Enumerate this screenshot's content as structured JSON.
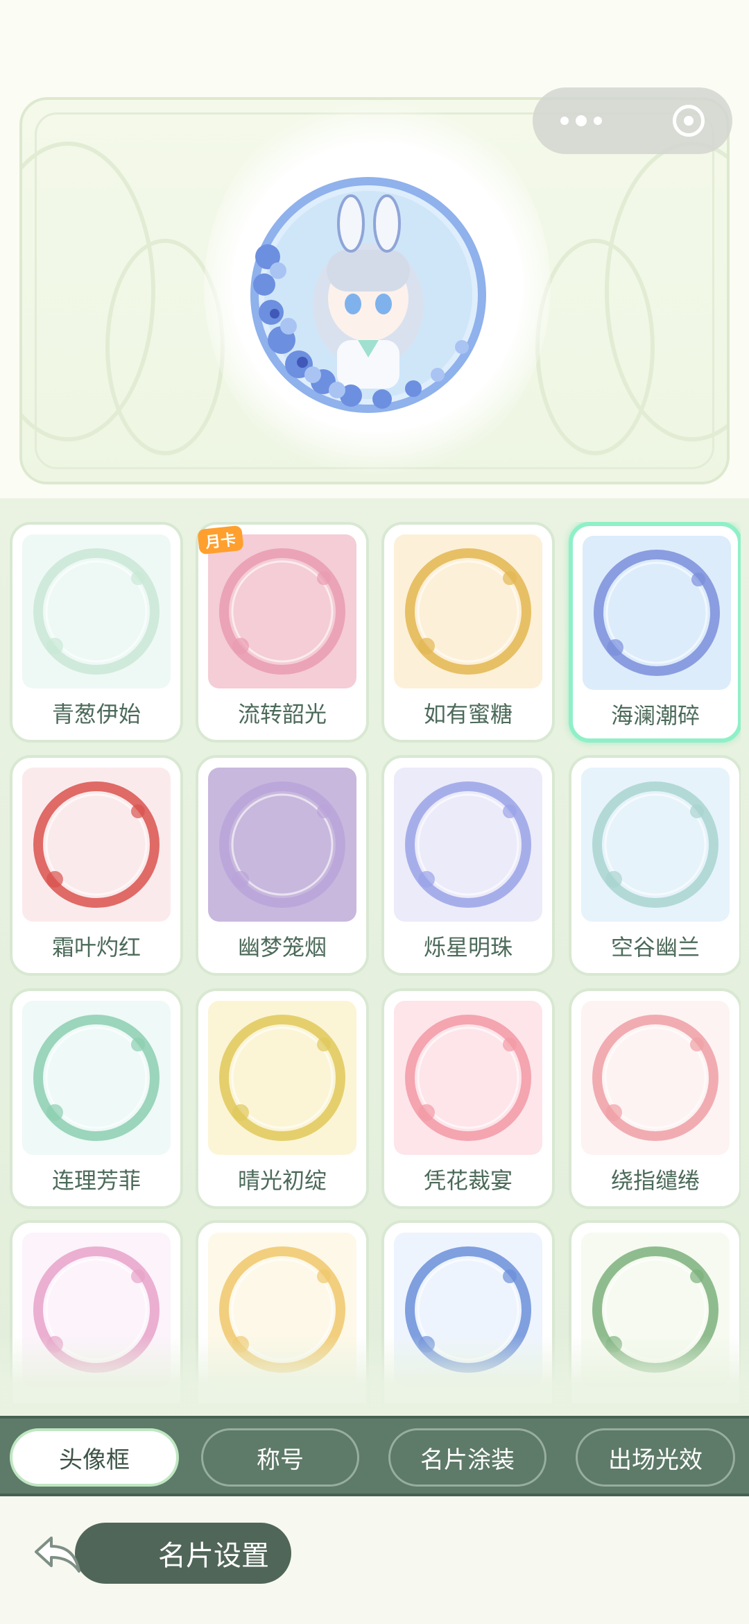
{
  "colors": {
    "accent": "#8ff0c7",
    "tab_bar": "#5e7a68",
    "label": "#4c6a5a"
  },
  "frames": [
    {
      "label": "青葱伊始",
      "bg": "#eef9f6"
    },
    {
      "label": "流转韶光",
      "bg": "#f4cdd6",
      "badge": "月卡"
    },
    {
      "label": "如有蜜糖",
      "bg": "#fdf0d8"
    },
    {
      "label": "海澜潮碎",
      "bg": "#dcecfb"
    },
    {
      "label": "霜叶灼红",
      "bg": "#fbeaec"
    },
    {
      "label": "幽梦笼烟",
      "bg": "#c8b8dd"
    },
    {
      "label": "烁星明珠",
      "bg": "#ecebf9"
    },
    {
      "label": "空谷幽兰",
      "bg": "#e6f3fb"
    },
    {
      "label": "连理芳菲",
      "bg": "#eef9f8"
    },
    {
      "label": "晴光初绽",
      "bg": "#fbf5d6"
    },
    {
      "label": "凭花裁宴",
      "bg": "#fde5ea"
    },
    {
      "label": "绕指缱绻",
      "bg": "#fdf3f3"
    },
    {
      "label": "",
      "bg": "#fcf3fb"
    },
    {
      "label": "",
      "bg": "#fdf8e8"
    },
    {
      "label": "",
      "bg": "#eef4fd"
    },
    {
      "label": "",
      "bg": "#f6faf0"
    }
  ],
  "tabs": [
    {
      "label": "头像框",
      "active": true
    },
    {
      "label": "称号"
    },
    {
      "label": "名片涂装"
    },
    {
      "label": "出场光效"
    }
  ],
  "bottom": {
    "back_label": "名片设置"
  }
}
